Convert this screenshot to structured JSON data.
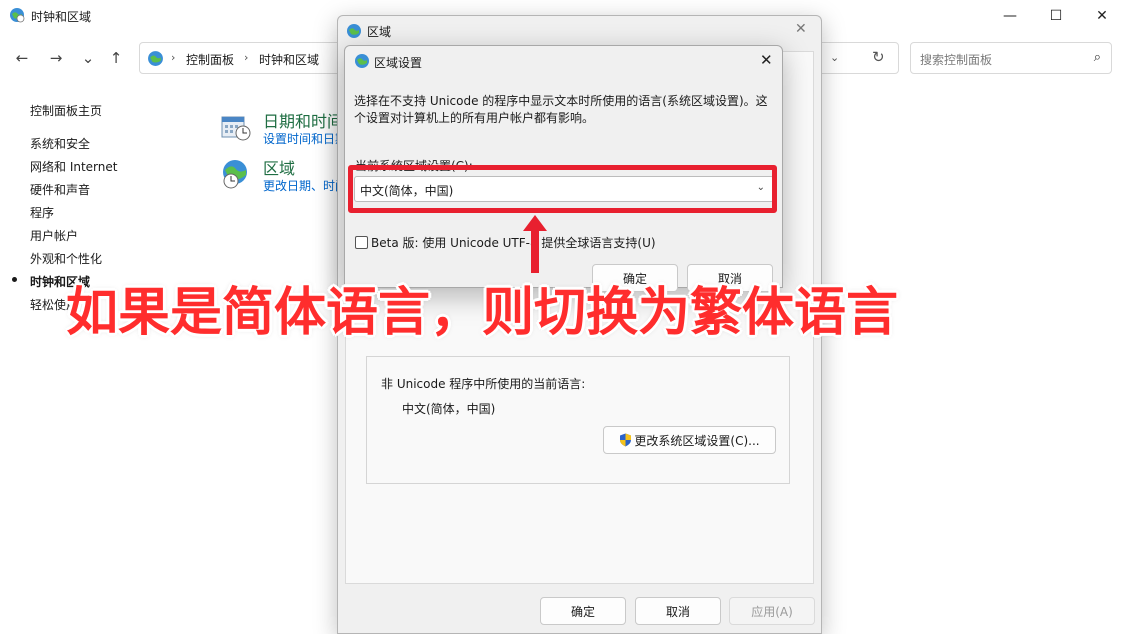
{
  "window": {
    "title": "时钟和区域",
    "minimize": "—",
    "maximize": "☐",
    "close": "✕"
  },
  "nav": {
    "back": "←",
    "forward": "→",
    "down": "⌄",
    "up": "↑"
  },
  "address": {
    "crumbs": [
      "控制面板",
      "时钟和区域"
    ],
    "separator": "›",
    "dropdown": "⌄",
    "refresh": "↻"
  },
  "search": {
    "placeholder": "搜索控制面板",
    "icon": "⌕"
  },
  "sidebar": {
    "items": [
      {
        "label": "控制面板主页"
      },
      {
        "label": "系统和安全"
      },
      {
        "label": "网络和 Internet"
      },
      {
        "label": "硬件和声音"
      },
      {
        "label": "程序"
      },
      {
        "label": "用户帐户"
      },
      {
        "label": "外观和个性化"
      },
      {
        "label": "时钟和区域",
        "current": true
      },
      {
        "label": "轻松使用"
      }
    ]
  },
  "categories": [
    {
      "title": "日期和时间",
      "subtitle": "设置时间和日期   更改时区",
      "icon": "calendar-clock-icon"
    },
    {
      "title": "区域",
      "subtitle": "更改日期、时间或数字格式",
      "icon": "globe-clock-icon"
    }
  ],
  "region_dialog": {
    "title": "区域",
    "close": "✕",
    "admin_text": "非 Unicode 程序中所使用的当前语言:",
    "current_language": "中文(简体，中国)",
    "change_button": "更改系统区域设置(C)...",
    "ok": "确定",
    "cancel": "取消",
    "apply": "应用(A)"
  },
  "region_settings": {
    "title": "区域设置",
    "close": "✕",
    "description": "选择在不支持 Unicode 的程序中显示文本时所使用的语言(系统区域设置)。这个设置对计算机上的所有用户帐户都有影响。",
    "current_label": "当前系统区域设置(C):",
    "current_value": "中文(简体，中国)",
    "chevron": "⌄",
    "beta_label": "Beta 版: 使用 Unicode UTF-8 提供全球语言支持(U)",
    "beta_checked": false,
    "ok": "确定",
    "cancel": "取消"
  },
  "annotation": {
    "caption": "如果是简体语言，则切换为繁体语言",
    "color": "#e8202f"
  }
}
